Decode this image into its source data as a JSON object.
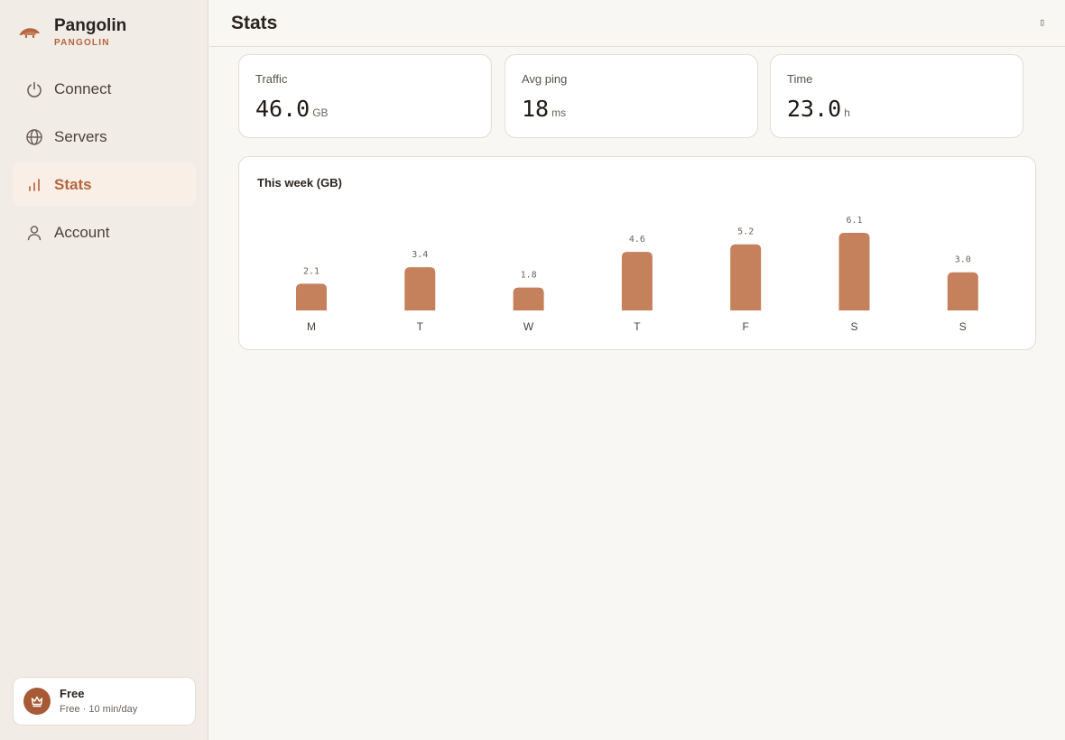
{
  "brand": {
    "name": "Pangolin",
    "subtitle": "PANGOLIN",
    "logo_icon": "pangolin-logo-icon"
  },
  "nav": {
    "items": [
      {
        "label": "Connect",
        "icon": "power-icon"
      },
      {
        "label": "Servers",
        "icon": "globe-icon"
      },
      {
        "label": "Stats",
        "icon": "bar-chart-icon",
        "active": true
      },
      {
        "label": "Account",
        "icon": "user-icon"
      }
    ]
  },
  "plan": {
    "title": "Free",
    "subtitle": "Free · 10 min/day",
    "icon": "crown-icon"
  },
  "header": {
    "title": "Stats",
    "icon_glyph": "▯"
  },
  "stats": [
    {
      "label": "Traffic",
      "value": "46.0",
      "unit": "GB"
    },
    {
      "label": "Avg ping",
      "value": "18",
      "unit": "ms"
    },
    {
      "label": "Time",
      "value": "23.0",
      "unit": "h"
    }
  ],
  "colors": {
    "accent": "#b5653f",
    "bar": "#c5805c",
    "active_bg": "#f9efe7"
  },
  "chart_data": {
    "type": "bar",
    "title": "This week (GB)",
    "categories": [
      "M",
      "T",
      "W",
      "T",
      "F",
      "S",
      "S"
    ],
    "values": [
      2.1,
      3.4,
      1.8,
      4.6,
      5.2,
      6.1,
      3.0
    ],
    "value_labels": [
      "2.1",
      "3.4",
      "1.8",
      "4.6",
      "5.2",
      "6.1",
      "3.0"
    ],
    "xlabel": "",
    "ylabel": "",
    "ylim": [
      0,
      6.1
    ],
    "grid": false,
    "legend": "none"
  }
}
